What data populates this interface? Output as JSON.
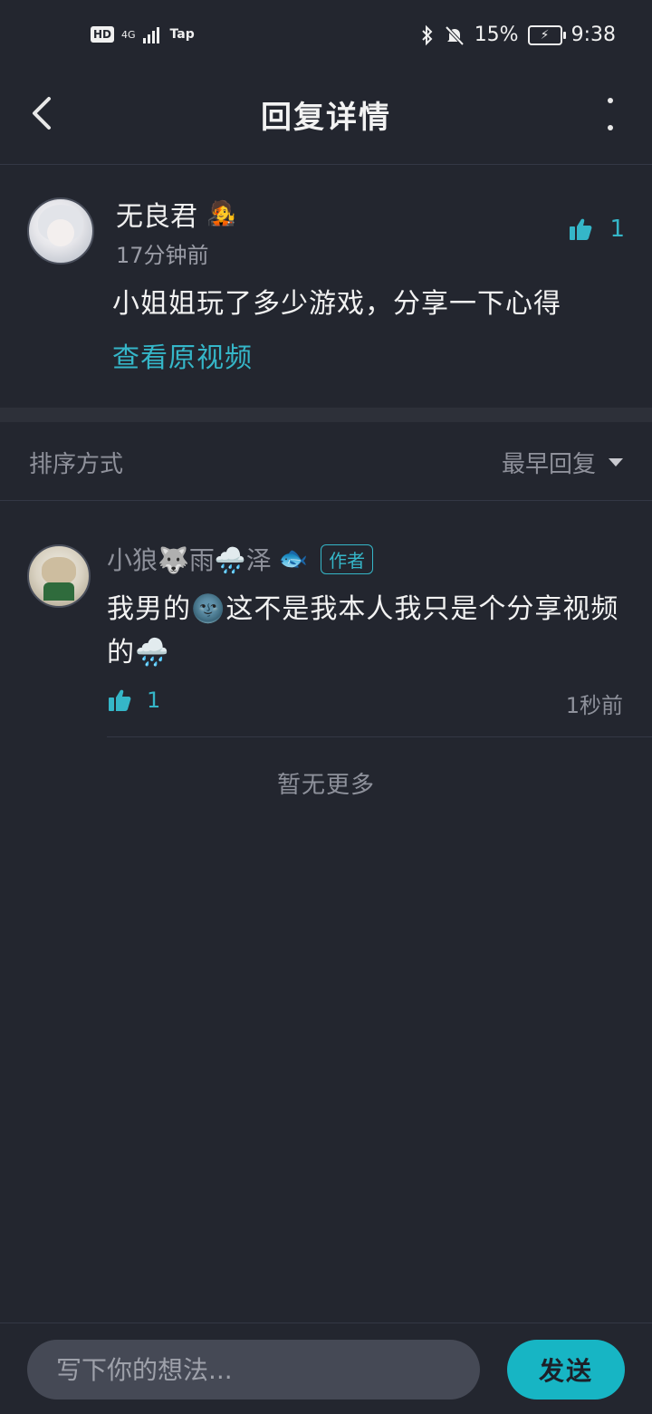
{
  "status_bar": {
    "hd": "HD",
    "network": "4G",
    "carrier": "Tap",
    "battery": "15%",
    "time": "9:38",
    "icons": [
      "bluetooth-icon",
      "mute-bell-icon",
      "battery-charging-icon"
    ]
  },
  "header": {
    "title": "回复详情"
  },
  "main_comment": {
    "username": "无良君",
    "badge_emoji": "🧑‍🎤",
    "time": "17分钟前",
    "text": "小姐姐玩了多少游戏，分享一下心得",
    "view_video": "查看原视频",
    "likes": "1"
  },
  "sort": {
    "label": "排序方式",
    "selected": "最早回复"
  },
  "replies": [
    {
      "username": "小狼🐺雨🌧️泽",
      "badge_emoji": "🐟",
      "author_tag": "作者",
      "text": "我男的🌚这不是我本人我只是个分享视频的🌧️",
      "likes": "1",
      "time": "1秒前"
    }
  ],
  "no_more": "暂无更多",
  "composer": {
    "placeholder": "写下你的想法...",
    "send_label": "发送"
  },
  "colors": {
    "background": "#23262f",
    "accent": "#35b6c8",
    "send_button": "#17b5c4"
  }
}
